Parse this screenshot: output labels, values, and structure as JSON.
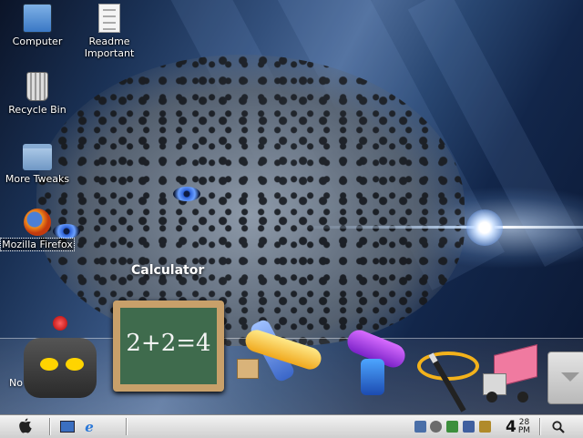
{
  "desktop": {
    "icons": [
      {
        "label": "Computer",
        "icon": "computer-icon"
      },
      {
        "label": "Readme\nImportant",
        "icon": "document-icon"
      },
      {
        "label": "Recycle Bin",
        "icon": "trash-icon"
      },
      {
        "label": "More Tweaks",
        "icon": "folder-icon"
      },
      {
        "label": "Mozilla Firefox",
        "icon": "firefox-icon",
        "selected": true
      }
    ],
    "wallpaper": "leopard-blue-streaks"
  },
  "dock": {
    "hover_label": "Calculator",
    "hidden_label": "No",
    "calculator_text": "2+2=4",
    "items": [
      {
        "icon": "robot-icon"
      },
      {
        "icon": "chalkboard-calculator-icon"
      },
      {
        "icon": "airplane-icon"
      },
      {
        "icon": "ray-gun-icon"
      },
      {
        "icon": "magic-wand-icon"
      },
      {
        "icon": "delivery-truck-icon"
      },
      {
        "icon": "stack-icon"
      }
    ]
  },
  "taskbar": {
    "start_icon": "apple-icon",
    "quick_launch": [
      {
        "icon": "show-desktop-icon"
      },
      {
        "icon": "internet-explorer-icon",
        "glyph": "e"
      }
    ],
    "tray": [
      {
        "icon": "network-icon",
        "color": "#4a6fa8"
      },
      {
        "icon": "clock-tray-icon",
        "color": "#6b6b6b"
      },
      {
        "icon": "update-icon",
        "color": "#3c8f3c"
      },
      {
        "icon": "display-icon",
        "color": "#3f5f9f"
      },
      {
        "icon": "tools-icon",
        "color": "#b08a2a"
      }
    ],
    "clock": {
      "hour": "4",
      "minutes": "28",
      "ampm": "PM"
    },
    "search_icon": "magnifier-icon"
  }
}
